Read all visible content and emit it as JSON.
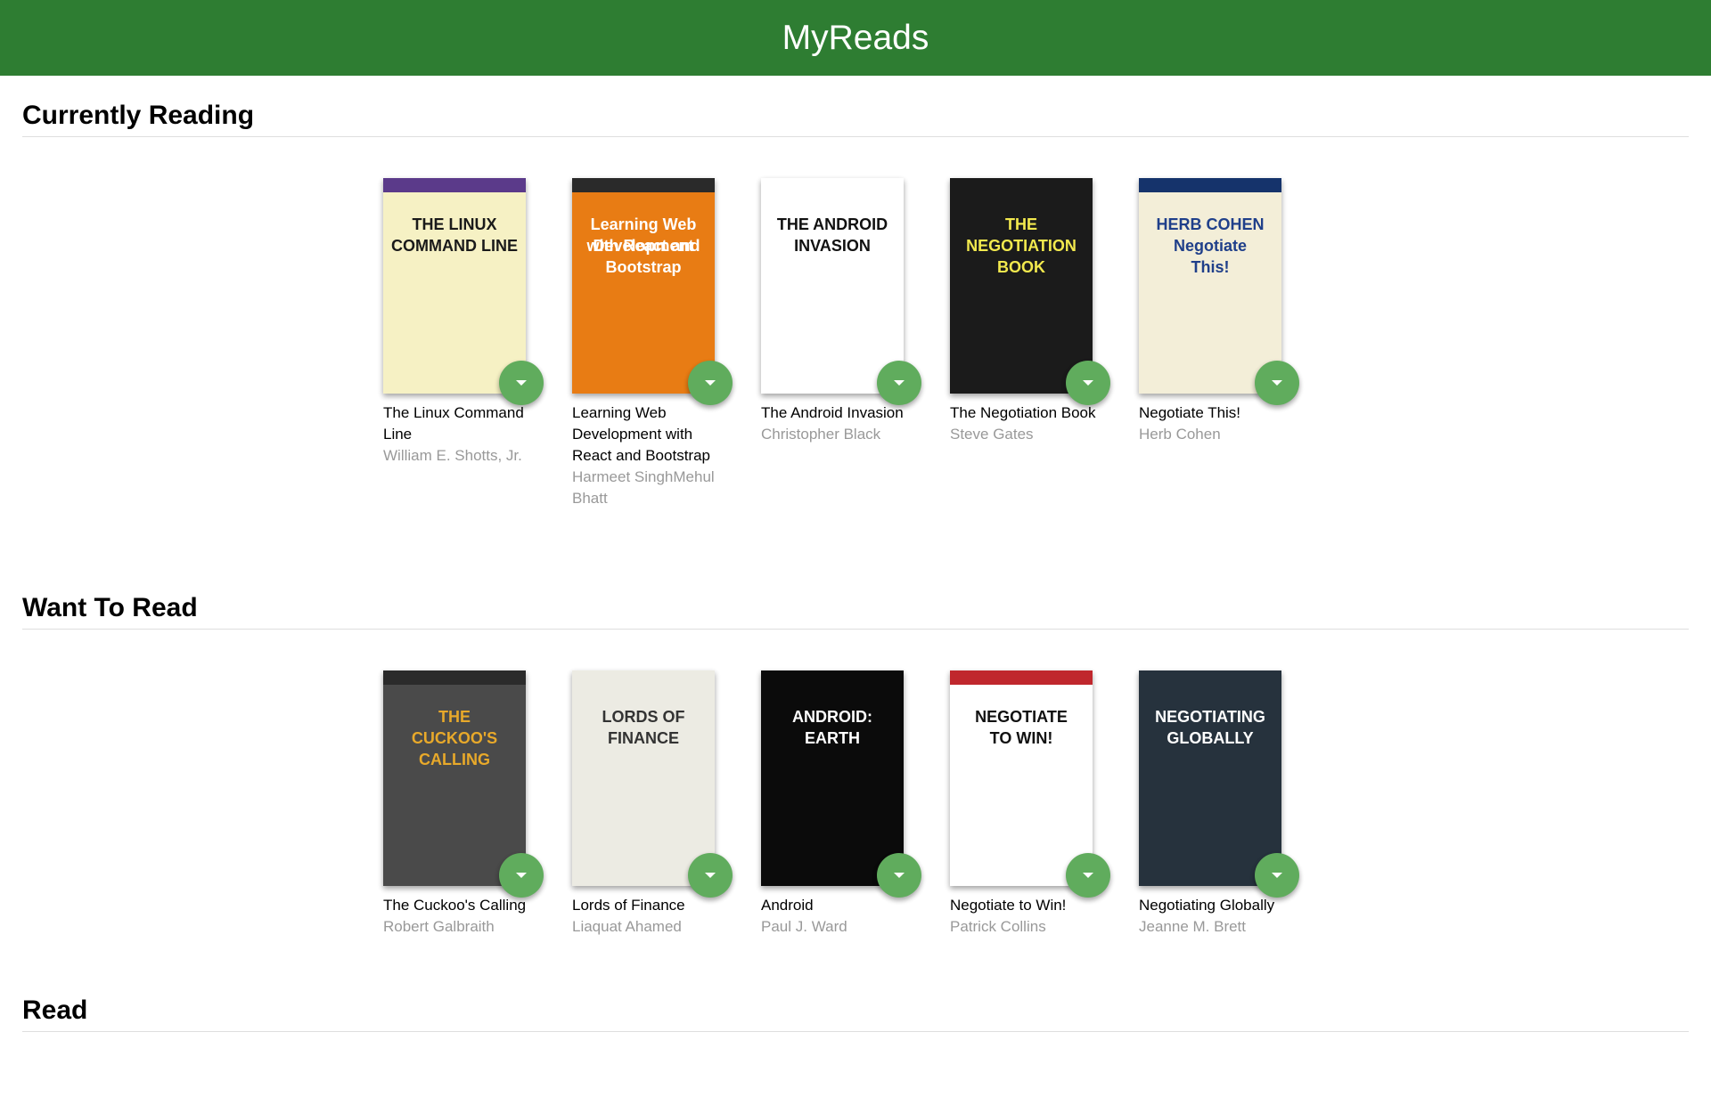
{
  "app": {
    "title": "MyReads"
  },
  "shelves": [
    {
      "title": "Currently Reading",
      "books": [
        {
          "title": "The Linux Command Line",
          "authors": "William E. Shotts, Jr.",
          "cover": {
            "bg": "#f6f1c4",
            "fg": "#1a1a1a",
            "band": "#5b3a8a",
            "lines": [
              "THE LINUX",
              "COMMAND LINE"
            ]
          }
        },
        {
          "title": "Learning Web Development with React and Bootstrap",
          "authors": "Harmeet SinghMehul Bhatt",
          "cover": {
            "bg": "#e87c14",
            "fg": "#ffffff",
            "band": "#2a2a2a",
            "lines": [
              "Learning Web Development",
              "with React and Bootstrap"
            ]
          }
        },
        {
          "title": "The Android Invasion",
          "authors": "Christopher Black",
          "cover": {
            "bg": "#ffffff",
            "fg": "#111111",
            "band": "#ffffff",
            "lines": [
              "THE ANDROID",
              "INVASION"
            ]
          }
        },
        {
          "title": "The Negotiation Book",
          "authors": "Steve Gates",
          "cover": {
            "bg": "#1b1b1b",
            "fg": "#f2e94e",
            "band": "#1b1b1b",
            "lines": [
              "THE",
              "NEGOTIATION",
              "BOOK"
            ]
          }
        },
        {
          "title": "Negotiate This!",
          "authors": "Herb Cohen",
          "cover": {
            "bg": "#f3eed8",
            "fg": "#1f3f8a",
            "band": "#15336b",
            "lines": [
              "HERB COHEN",
              "Negotiate",
              "This!"
            ]
          }
        }
      ]
    },
    {
      "title": "Want To Read",
      "books": [
        {
          "title": "The Cuckoo's Calling",
          "authors": "Robert Galbraith",
          "cover": {
            "bg": "#4a4a4a",
            "fg": "#e8a92a",
            "band": "#2b2b2b",
            "lines": [
              "THE",
              "CUCKOO'S",
              "CALLING"
            ]
          }
        },
        {
          "title": "Lords of Finance",
          "authors": "Liaquat Ahamed",
          "cover": {
            "bg": "#ecebe3",
            "fg": "#333333",
            "band": "#ecebe3",
            "lines": [
              "LORDS OF FINANCE"
            ]
          }
        },
        {
          "title": "Android",
          "authors": "Paul J. Ward",
          "cover": {
            "bg": "#0b0b0b",
            "fg": "#ffffff",
            "band": "#0b0b0b",
            "lines": [
              "ANDROID:",
              "EARTH"
            ]
          }
        },
        {
          "title": "Negotiate to Win!",
          "authors": "Patrick Collins",
          "cover": {
            "bg": "#ffffff",
            "fg": "#111111",
            "band": "#c0272d",
            "lines": [
              "NEGOTIATE",
              "TO WIN!"
            ]
          }
        },
        {
          "title": "Negotiating Globally",
          "authors": "Jeanne M. Brett",
          "cover": {
            "bg": "#26323d",
            "fg": "#ffffff",
            "band": "#26323d",
            "lines": [
              "NEGOTIATING",
              "GLOBALLY"
            ]
          }
        }
      ]
    },
    {
      "title": "Read",
      "books": []
    }
  ],
  "icons": {
    "shelf_changer": "caret-down-icon"
  },
  "colors": {
    "header": "#2e7d32",
    "changer": "#60ac5d",
    "author": "#999999"
  }
}
